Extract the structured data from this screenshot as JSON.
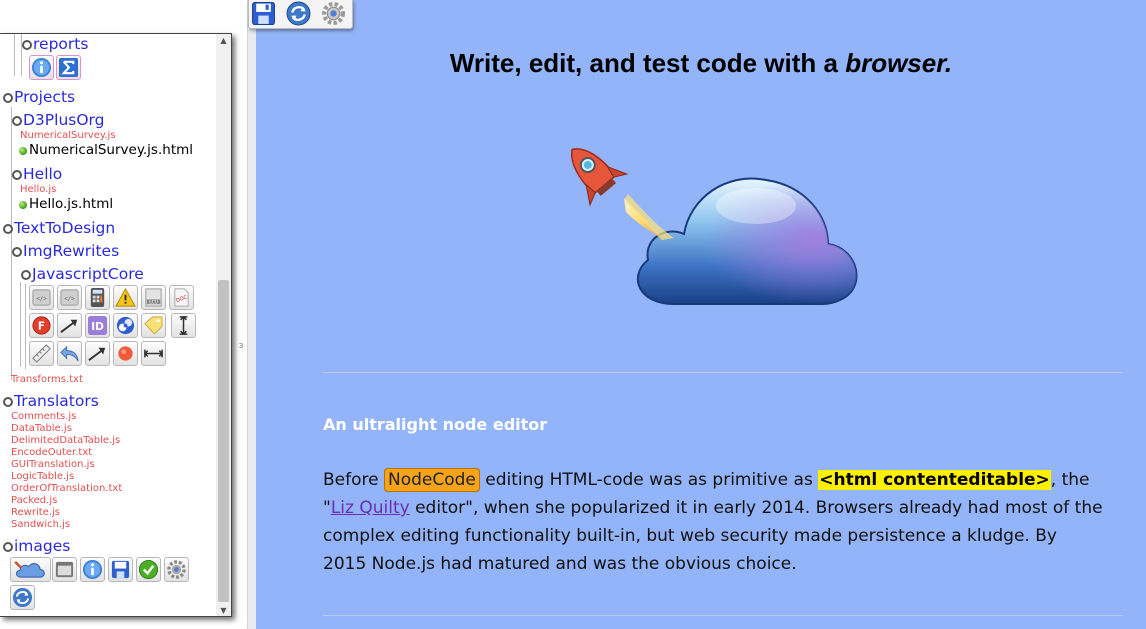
{
  "sidebar": {
    "tree": [
      {
        "kind": "folder",
        "label": "reports"
      },
      {
        "kind": "folder",
        "label": "Projects"
      },
      {
        "kind": "folder",
        "label": "D3PlusOrg"
      },
      {
        "kind": "js",
        "label": "NumericalSurvey.js"
      },
      {
        "kind": "html",
        "label": "NumericalSurvey.js.html"
      },
      {
        "kind": "folder",
        "label": "Hello"
      },
      {
        "kind": "js",
        "label": "Hello.js"
      },
      {
        "kind": "html",
        "label": "Hello.js.html"
      },
      {
        "kind": "folder",
        "label": "TextToDesign"
      },
      {
        "kind": "folder",
        "label": "ImgRewrites"
      },
      {
        "kind": "folder",
        "label": "JavascriptCore"
      },
      {
        "kind": "file",
        "label": "Transforms.txt"
      },
      {
        "kind": "folder",
        "label": "Translators"
      },
      {
        "kind": "js",
        "label": "Comments.js"
      },
      {
        "kind": "js",
        "label": "DataTable.js"
      },
      {
        "kind": "js",
        "label": "DelimitedDataTable.js"
      },
      {
        "kind": "js",
        "label": "EncodeOuter.txt"
      },
      {
        "kind": "js",
        "label": "GUITranslation.js"
      },
      {
        "kind": "js",
        "label": "LogicTable.js"
      },
      {
        "kind": "js",
        "label": "OrderOfTranslation.txt"
      },
      {
        "kind": "js",
        "label": "Packed.js"
      },
      {
        "kind": "js",
        "label": "Rewrite.js"
      },
      {
        "kind": "js",
        "label": "Sandwich.js"
      },
      {
        "kind": "folder",
        "label": "images"
      }
    ],
    "reports_icons": [
      "info-icon",
      "sigma-icon"
    ],
    "core_icons": [
      "code-file-icon",
      "code-file-icon",
      "calculator-icon",
      "warning-icon",
      "lcu-file-icon",
      "doc-file-icon",
      "f-circle-icon",
      "arrow-right-icon",
      "id-icon",
      "blend-icon",
      "tag-icon",
      "vertical-measure-icon",
      "ruler-icon",
      "undo-arrow-icon",
      "arrow-right-icon",
      "red-dot-icon",
      "horizontal-measure-icon"
    ],
    "image_icons": [
      "cloud-rocket-icon",
      "window-icon",
      "info-icon",
      "save-icon",
      "check-icon",
      "gear-icon",
      "refresh-icon"
    ],
    "splitter_grip": "3"
  },
  "toolbar": {
    "buttons": [
      "save-icon",
      "refresh-icon",
      "settings-icon"
    ]
  },
  "main": {
    "heading_prefix": "Write, edit, and test code with a ",
    "heading_emphasis": "browser.",
    "subheading": "An ultralight node editor",
    "paragraph": {
      "before": "Before ",
      "badge": "NodeCode",
      "t1": " editing HTML-code was as primitive as ",
      "code": "<html contenteditable>",
      "t2": ", the \"",
      "link": "Liz Quilty",
      "t3": " editor\", when she popularized it in early 2014. Browsers already had most of the complex editing functionality built-in, but web security made persistence a kludge. By 2015 Node.js had matured and was the obvious choice."
    }
  },
  "colors": {
    "main_background": "#94b4f9",
    "folder_text": "#2b2bd6",
    "js_file_text": "#e35050",
    "badge": "#f5a31a",
    "code_highlight": "#fff000",
    "link": "#6a2eb2"
  }
}
